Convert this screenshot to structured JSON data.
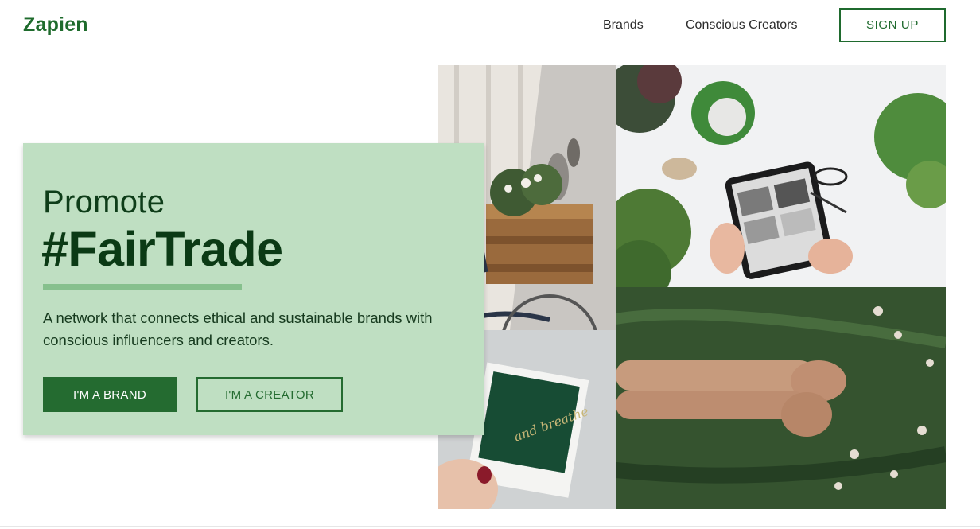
{
  "header": {
    "logo": "Zapien",
    "nav": [
      {
        "label": "Brands"
      },
      {
        "label": "Conscious Creators"
      }
    ],
    "signup_label": "SIGN UP"
  },
  "hero": {
    "line1": "Promote",
    "hashtag": "#FairTrade",
    "tagline": "A network that connects ethical and sustainable brands with conscious influencers and creators.",
    "brand_button": "I'M A BRAND",
    "creator_button": "I'M A CREATOR"
  },
  "collage": {
    "polaroid_text": "and breathe"
  },
  "colors": {
    "brand_green": "#1e6b2c",
    "hero_card": "#bfdfc2",
    "accent_bar": "#86c08d",
    "dark_text": "#0b3a15"
  }
}
